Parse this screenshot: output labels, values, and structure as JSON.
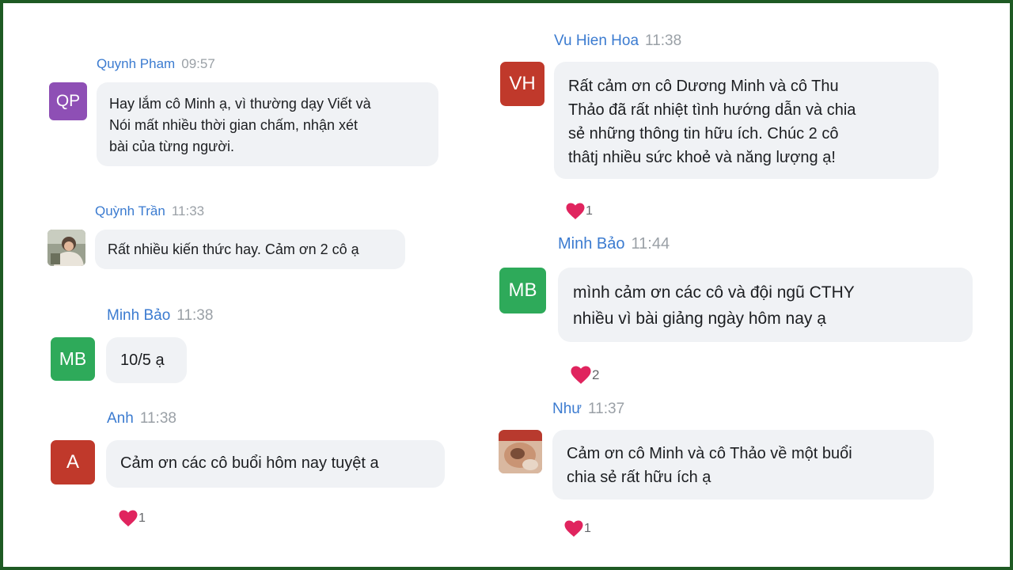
{
  "reaction_icon": "heart-icon",
  "colors": {
    "frame": "#1e5a23",
    "name": "#3b7bd0",
    "time": "#9aa0a6",
    "bubble": "#f0f2f5",
    "heart": "#e0245e"
  },
  "messages": [
    {
      "id": "quynh-pham",
      "author": "Quynh Pham",
      "time": "09:57",
      "avatar": {
        "initials": "QP",
        "color": "#8e4fb5"
      },
      "text": "Hay lắm cô Minh ạ, vì thường dạy Viết và\nNói mất nhiều thời gian chấm, nhận xét\nbài của từng người."
    },
    {
      "id": "quynh-tran",
      "author": "Quỳnh Trần",
      "time": "11:33",
      "avatar": {
        "initials": "",
        "color": "#8a8f86",
        "photo": true
      },
      "text": "Rất nhiều kiến thức hay. Cảm ơn 2 cô ạ"
    },
    {
      "id": "minh-bao-1",
      "author": "Minh Bảo",
      "time": "11:38",
      "avatar": {
        "initials": "MB",
        "color": "#2eaa5a"
      },
      "text": "10/5 ạ"
    },
    {
      "id": "anh",
      "author": "Anh",
      "time": "11:38",
      "avatar": {
        "initials": "A",
        "color": "#c0392b"
      },
      "text": "Cảm ơn các cô buổi hôm nay tuyệt a",
      "reaction_count": "1"
    },
    {
      "id": "vu-hien-hoa",
      "author": "Vu Hien Hoa",
      "time": "11:38",
      "avatar": {
        "initials": "VH",
        "color": "#c0392b"
      },
      "text": "Rất cảm ơn cô Dương Minh và cô Thu\nThảo đã rất nhiệt tình hướng dẫn và chia\nsẻ những thông tin hữu ích. Chúc 2 cô\nthâtj nhiều sức khoẻ và năng lượng ạ!",
      "reaction_count": "1"
    },
    {
      "id": "minh-bao-2",
      "author": "Minh Bảo",
      "time": "11:44",
      "avatar": {
        "initials": "MB",
        "color": "#2eaa5a"
      },
      "text": "mình cảm ơn các cô và đội ngũ CTHY\nnhiều vì bài giảng ngày hôm nay ạ",
      "reaction_count": "2"
    },
    {
      "id": "nhu",
      "author": "Như",
      "time": "11:37",
      "avatar": {
        "initials": "",
        "color": "#b98b6e",
        "photo": true
      },
      "text": "Cảm ơn cô Minh và cô Thảo về một buổi\nchia sẻ rất hữu ích ạ",
      "reaction_count": "1"
    }
  ]
}
